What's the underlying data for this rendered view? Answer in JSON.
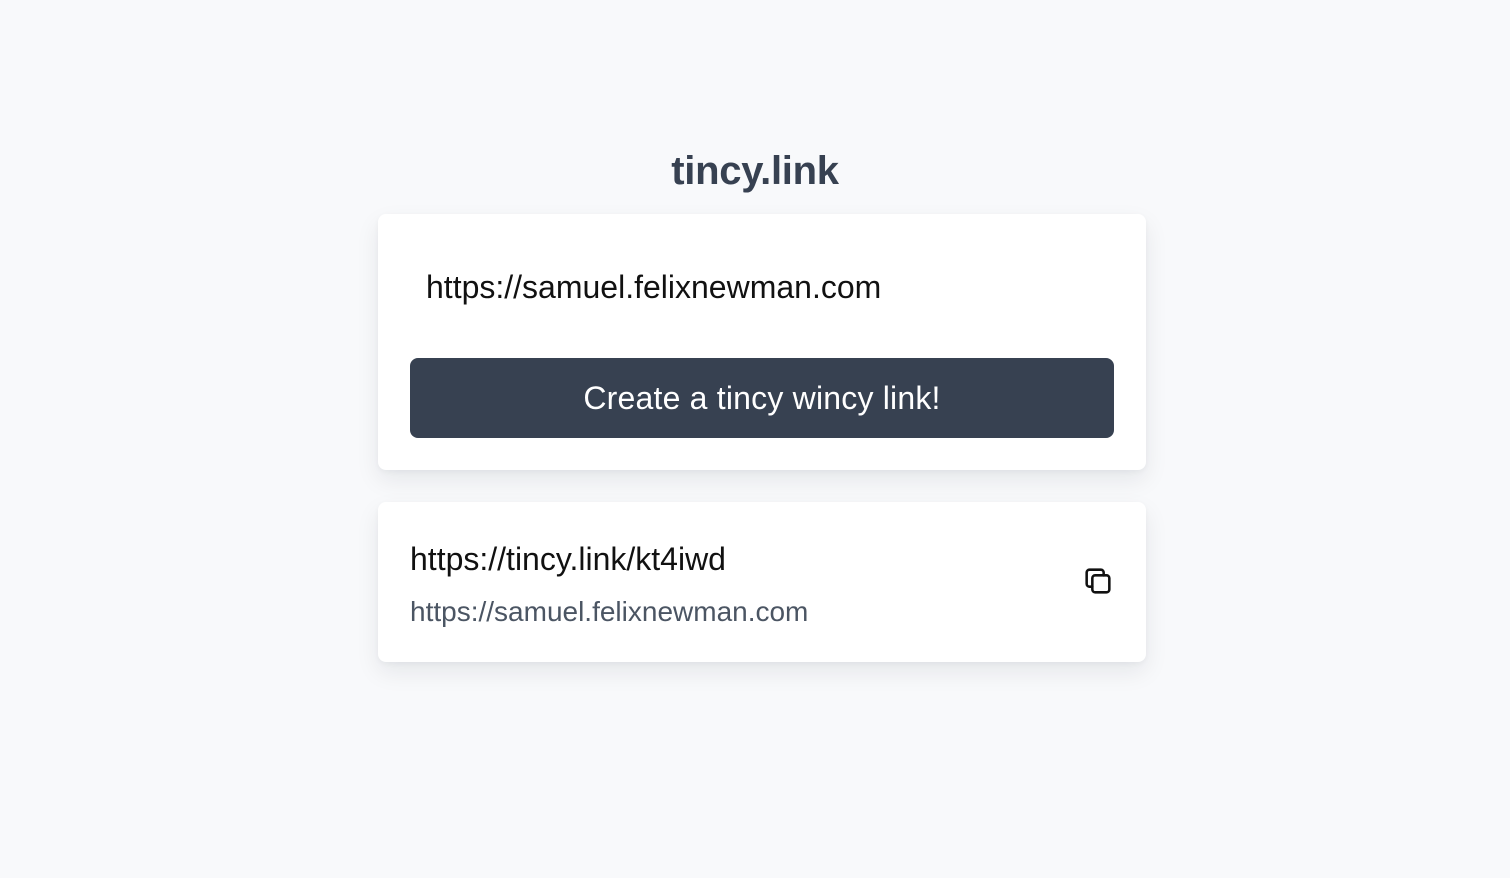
{
  "app": {
    "title": "tincy.link"
  },
  "form": {
    "url_value": "https://samuel.felixnewman.com",
    "submit_label": "Create a tincy wincy link!"
  },
  "result": {
    "short_url": "https://tincy.link/kt4iwd",
    "original_url": "https://samuel.felixnewman.com",
    "copy_icon": "copy-icon"
  },
  "colors": {
    "background": "#f8f9fb",
    "card": "#ffffff",
    "button": "#374151",
    "title": "#374151",
    "muted_text": "#4b5563"
  }
}
